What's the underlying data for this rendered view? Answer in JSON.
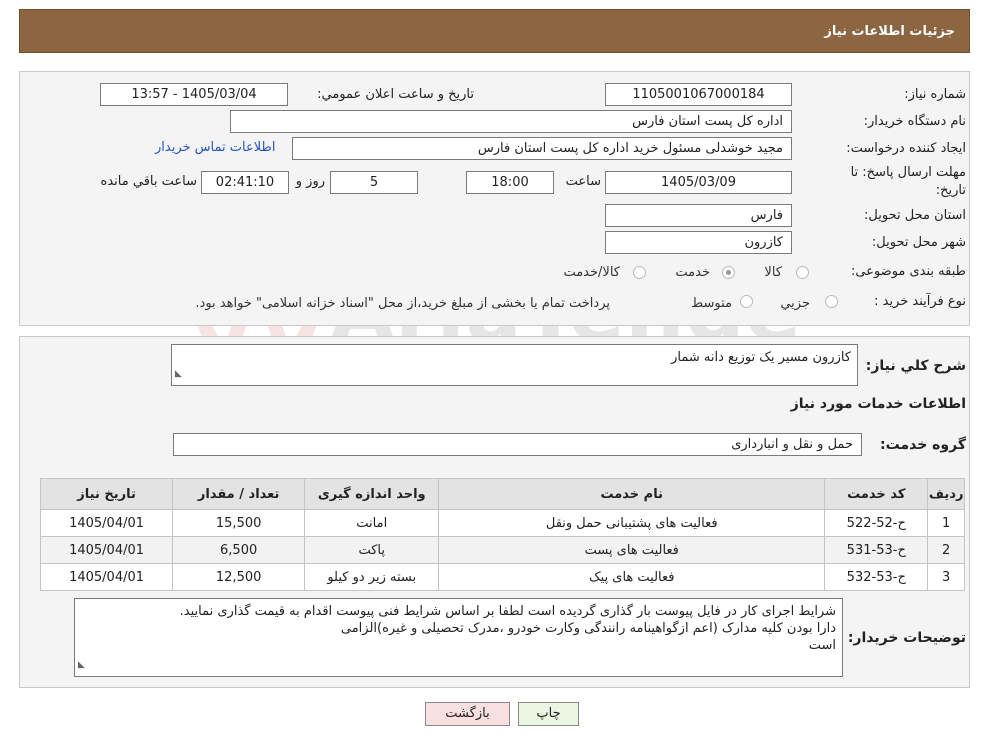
{
  "header": {
    "title": "جزئیات اطلاعات نیاز"
  },
  "form": {
    "need_number": {
      "label": "شماره نياز:",
      "value": "1105001067000184"
    },
    "announce": {
      "label": "تاريخ و ساعت اعلان عمومي:",
      "value": "1405/03/04 - 13:57"
    },
    "buyer": {
      "label": "نام دستگاه خريدار:",
      "value": "اداره کل پست استان فارس"
    },
    "creator": {
      "label": "ايجاد کننده درخواست:",
      "value": "مجید خوشدلی مسئول خرید اداره کل پست استان فارس",
      "contact_link": "اطلاعات تماس خريدار"
    },
    "deadline": {
      "label_line1": "مهلت ارسال پاسخ: تا",
      "label_line2": "تاريخ:",
      "date": "1405/03/09",
      "time_label": "ساعت",
      "time": "18:00",
      "days": "5",
      "days_label": "روز و",
      "remaining": "02:41:10",
      "remaining_label": "ساعت باقي مانده"
    },
    "province": {
      "label": "استان محل تحويل:",
      "value": "فارس"
    },
    "city": {
      "label": "شهر محل تحويل:",
      "value": "کازرون"
    },
    "category": {
      "label": "طبقه بندی موضوعی:",
      "options": [
        "کالا",
        "خدمت",
        "کالا/خدمت"
      ],
      "selected": "خدمت"
    },
    "purchase_type": {
      "label": "نوع فرآيند خريد :",
      "options": [
        "جزيي",
        "متوسط"
      ],
      "note": "پرداخت تمام يا بخشی از مبلغ خريد،از محل \"اسناد خزانه اسلامی\" خواهد بود."
    }
  },
  "details": {
    "summary_label": "شرح کلي نياز:",
    "summary": "کازرون مسیر یک توزیع دانه شمار",
    "services_title": "اطلاعات خدمات مورد نياز",
    "group_label": "گروه خدمت:",
    "group": "حمل و نقل و انبارداری",
    "table": {
      "headers": [
        "رديف",
        "کد خدمت",
        "نام خدمت",
        "واحد اندازه گيری",
        "تعداد / مقدار",
        "تاريخ نياز"
      ],
      "rows": [
        [
          "1",
          "ح-52-522",
          "فعالیت های پشتیبانی حمل ونقل",
          "امانت",
          "15,500",
          "1405/04/01"
        ],
        [
          "2",
          "ح-53-531",
          "فعالیت های پست",
          "پاکت",
          "6,500",
          "1405/04/01"
        ],
        [
          "3",
          "ح-53-532",
          "فعالیت های پیک",
          "بسته زیر دو کیلو",
          "12,500",
          "1405/04/01"
        ]
      ]
    },
    "buyer_notes_label": "توضيحات خريدار:",
    "buyer_notes": [
      "شرایط اجرای کار در فایل پیوست بار گذاری گردیده است لطفا بر اساس شرایط فنی پیوست اقدام به قیمت گذاری نمایید.",
      "دارا بودن کلیه مدارک (اعم ازگواهینامه رانندگی وکارت خودرو ،مدرک تحصیلی و غیره)الزامی",
      "است"
    ]
  },
  "buttons": {
    "print": "چاپ",
    "back": "بازگشت"
  },
  "watermark": "AriaTender.net"
}
